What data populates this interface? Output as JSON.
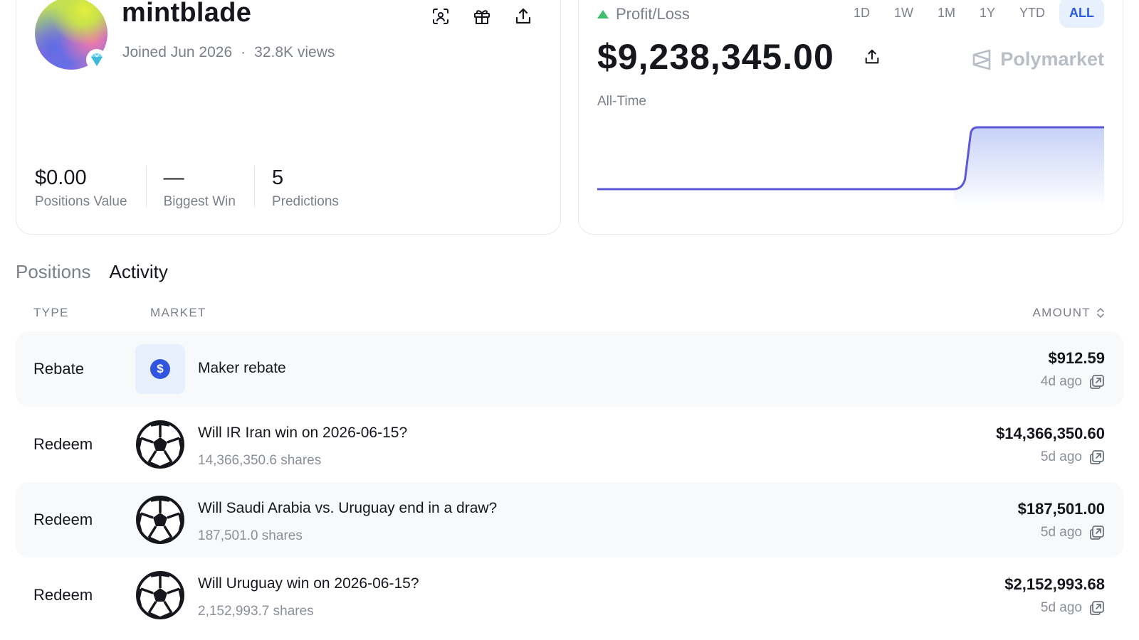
{
  "profile": {
    "username": "mintblade",
    "joined": "Joined Jun 2026",
    "separator": "·",
    "views": "32.8K views",
    "icons": [
      "scan-icon",
      "gift-icon",
      "share-icon"
    ],
    "stats": [
      {
        "value": "$0.00",
        "label": "Positions Value"
      },
      {
        "value": "—",
        "label": "Biggest Win"
      },
      {
        "value": "5",
        "label": "Predictions"
      }
    ]
  },
  "pnl": {
    "label": "Profit/Loss",
    "ranges": [
      "1D",
      "1W",
      "1M",
      "1Y",
      "YTD",
      "ALL"
    ],
    "active_range": "ALL",
    "value": "$9,238,345.00",
    "period": "All-Time",
    "brand": "Polymarket",
    "colors": {
      "positive": "#3fbf6d",
      "line": "#5c57d6",
      "accent": "#2a5be0"
    },
    "chart_shape": {
      "level_before": 0,
      "level_after": 1,
      "jump_at_fraction": 0.72
    }
  },
  "tabs": [
    "Positions",
    "Activity"
  ],
  "active_tab": "Activity",
  "table": {
    "headers": {
      "type": "TYPE",
      "market": "MARKET",
      "amount": "AMOUNT"
    },
    "rows": [
      {
        "type": "Rebate",
        "icon": "dollar-coin-icon",
        "title": "Maker rebate",
        "subtitle": "",
        "amount": "$912.59",
        "time": "4d ago"
      },
      {
        "type": "Redeem",
        "icon": "soccer-ball-icon",
        "title": "Will IR Iran win on 2026-06-15?",
        "subtitle": "14,366,350.6 shares",
        "amount": "$14,366,350.60",
        "time": "5d ago"
      },
      {
        "type": "Redeem",
        "icon": "soccer-ball-icon",
        "title": "Will Saudi Arabia vs. Uruguay end in a draw?",
        "subtitle": "187,501.0 shares",
        "amount": "$187,501.00",
        "time": "5d ago"
      },
      {
        "type": "Redeem",
        "icon": "soccer-ball-icon",
        "title": "Will Uruguay win on 2026-06-15?",
        "subtitle": "2,152,993.7 shares",
        "amount": "$2,152,993.68",
        "time": "5d ago"
      }
    ]
  }
}
